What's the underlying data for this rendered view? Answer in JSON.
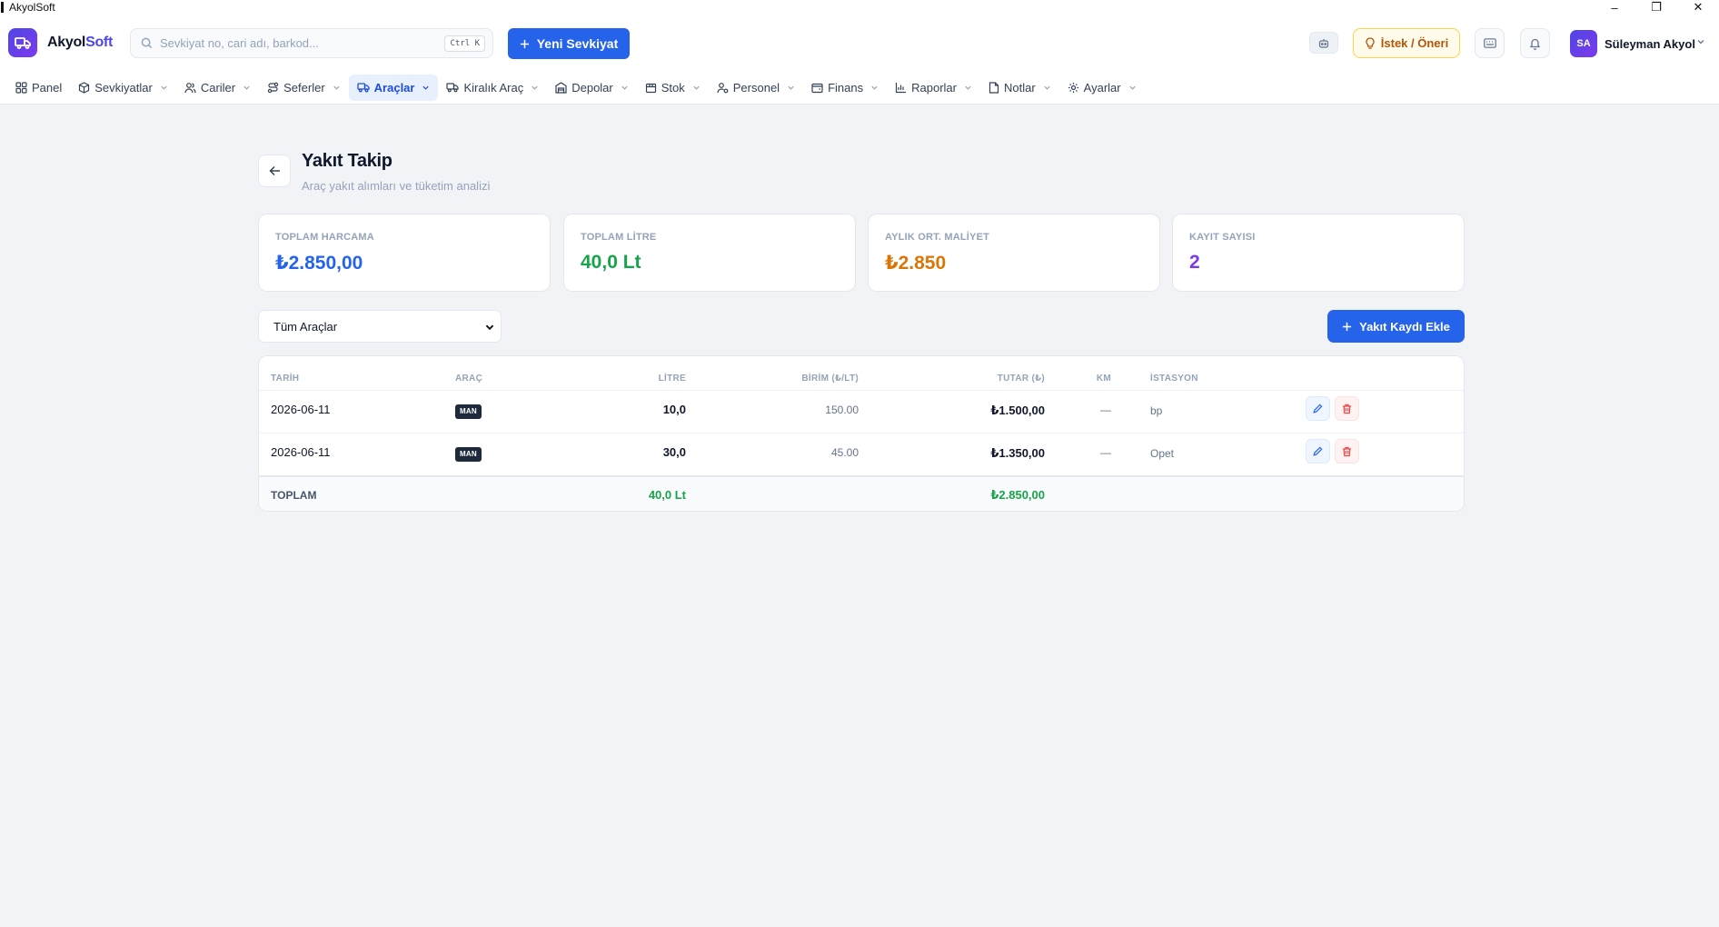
{
  "window": {
    "title": "AkyolSoft",
    "minimize": "–",
    "restore": "❐",
    "close": "✕"
  },
  "header": {
    "brand_main": "Akyol",
    "brand_accent": "Soft",
    "search_placeholder": "Sevkiyat no, cari adı, barkod...",
    "search_value": "",
    "search_shortcut": "Ctrl K",
    "new_shipment_label": "Yeni Sevkiyat",
    "suggestion_label": "İstek / Öneri",
    "user_initials": "SA",
    "user_name": "Süleyman Akyol"
  },
  "nav": {
    "items": [
      {
        "label": "Panel",
        "icon": "grid-icon",
        "has_menu": false
      },
      {
        "label": "Sevkiyatlar",
        "icon": "package-icon",
        "has_menu": true
      },
      {
        "label": "Cariler",
        "icon": "users-icon",
        "has_menu": true
      },
      {
        "label": "Seferler",
        "icon": "route-icon",
        "has_menu": true
      },
      {
        "label": "Araçlar",
        "icon": "truck-icon",
        "has_menu": true,
        "active": true
      },
      {
        "label": "Kiralık Araç",
        "icon": "truck-icon",
        "has_menu": true
      },
      {
        "label": "Depolar",
        "icon": "warehouse-icon",
        "has_menu": true
      },
      {
        "label": "Stok",
        "icon": "box-icon",
        "has_menu": true
      },
      {
        "label": "Personel",
        "icon": "person-icon",
        "has_menu": true
      },
      {
        "label": "Finans",
        "icon": "wallet-icon",
        "has_menu": true
      },
      {
        "label": "Raporlar",
        "icon": "chart-icon",
        "has_menu": true
      },
      {
        "label": "Notlar",
        "icon": "note-icon",
        "has_menu": true
      },
      {
        "label": "Ayarlar",
        "icon": "gear-icon",
        "has_menu": true
      }
    ]
  },
  "page": {
    "title": "Yakıt Takip",
    "subtitle": "Araç yakıt alımları ve tüketim analizi"
  },
  "stats": [
    {
      "label": "TOPLAM HARCAMA",
      "value": "₺2.850,00",
      "color": "#2563eb"
    },
    {
      "label": "TOPLAM LİTRE",
      "value": "40,0 Lt",
      "color": "#16a34a"
    },
    {
      "label": "AYLIK ORT. MALİYET",
      "value": "₺2.850",
      "color": "#d97706"
    },
    {
      "label": "KAYIT SAYISI",
      "value": "2",
      "color": "#7c3aed"
    }
  ],
  "filter": {
    "vehicle_selected": "Tüm Araçlar"
  },
  "actions": {
    "add_fuel_label": "Yakıt Kaydı Ekle"
  },
  "table": {
    "columns": [
      "TARİH",
      "ARAÇ",
      "LİTRE",
      "BİRİM (₺/LT)",
      "TUTAR (₺)",
      "KM",
      "İSTASYON"
    ],
    "rows": [
      {
        "date": "2026-06-11",
        "vehicle": "MAN",
        "liters": "10,0",
        "unit_price": "150.00",
        "amount": "₺1.500,00",
        "km": "—",
        "station": "bp"
      },
      {
        "date": "2026-06-11",
        "vehicle": "MAN",
        "liters": "30,0",
        "unit_price": "45.00",
        "amount": "₺1.350,00",
        "km": "—",
        "station": "Opet"
      }
    ],
    "footer": {
      "label": "TOPLAM",
      "liters": "40,0 Lt",
      "amount": "₺2.850,00"
    }
  },
  "colors": {
    "primary": "#2563eb",
    "active_nav_bg": "#e8effd",
    "positive": "#16a34a",
    "warning": "#d97706",
    "accent": "#7c3aed",
    "danger": "#ef4444"
  }
}
